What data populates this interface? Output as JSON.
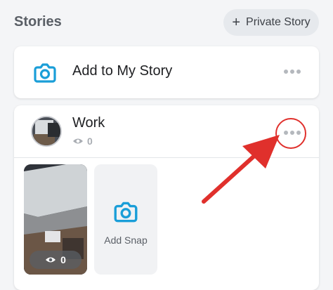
{
  "header": {
    "title": "Stories",
    "private_story_label": "Private Story"
  },
  "add_story": {
    "label": "Add to My Story",
    "icon": "camera-icon"
  },
  "story": {
    "name": "Work",
    "view_count": "0",
    "snaps": [
      {
        "view_count": "0"
      }
    ],
    "add_snap_label": "Add Snap"
  },
  "colors": {
    "accent": "#1a9ed8",
    "highlight": "#e0302c",
    "background": "#f4f5f7"
  }
}
